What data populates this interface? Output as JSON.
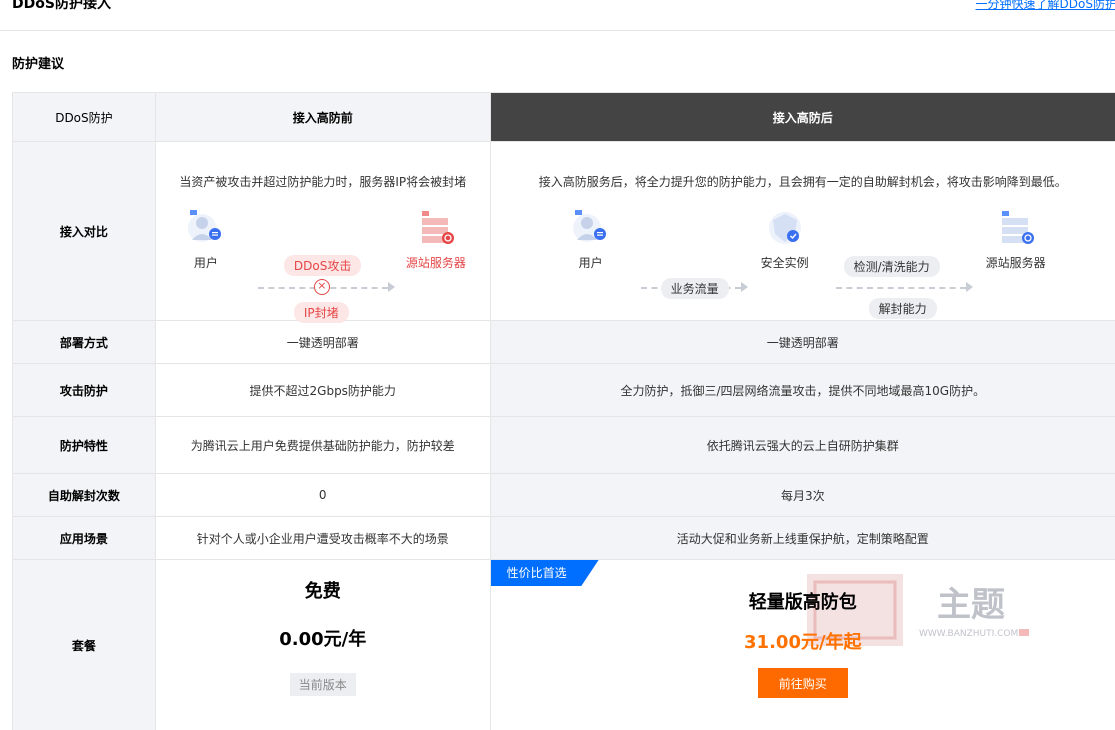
{
  "header": {
    "title": "DDoS防护接入",
    "help_link": "一分钟快速了解DDoS防护"
  },
  "section_title": "防护建议",
  "table": {
    "col_headers": [
      "DDoS防护",
      "接入高防前",
      "接入高防后"
    ],
    "compare_label": "接入对比",
    "before": {
      "caption": "当资产被攻击并超过防护能力时，服务器IP将会被封堵",
      "user_label": "用户",
      "attack_pill": "DDoS攻击",
      "block_pill": "IP封堵",
      "server_label": "源站服务器"
    },
    "after": {
      "caption": "接入高防服务后，将全力提升您的防护能力，且会拥有一定的自助解封机会，将攻击影响降到最低。",
      "user_label": "用户",
      "traffic_pill": "业务流量",
      "instance_label": "安全实例",
      "clean_pill": "检测/清洗能力",
      "unblock_pill": "解封能力",
      "server_label": "源站服务器"
    },
    "rows": [
      {
        "label": "部署方式",
        "before": "一键透明部署",
        "after": "一键透明部署"
      },
      {
        "label": "攻击防护",
        "before": "提供不超过2Gbps防护能力",
        "after": "全力防护，抵御三/四层网络流量攻击，提供不同地域最高10G防护。"
      },
      {
        "label": "防护特性",
        "before": "为腾讯云上用户免费提供基础防护能力，防护较差",
        "after": "依托腾讯云强大的云上自研防护集群"
      },
      {
        "label": "自助解封次数",
        "before": "0",
        "after": "每月3次"
      },
      {
        "label": "应用场景",
        "before": "针对个人或小企业用户遭受攻击概率不大的场景",
        "after": "活动大促和业务新上线重保护航，定制策略配置"
      }
    ],
    "package": {
      "label": "套餐",
      "before_name": "免费",
      "before_price": "0.00元/年",
      "before_badge": "当前版本",
      "ribbon": "性价比首选",
      "after_name": "轻量版高防包",
      "after_price": "31.00元/年起",
      "buy_label": "前往购买"
    }
  },
  "watermark": {
    "title": "主题",
    "url": "WWW.BANZHUTI.COM"
  },
  "colors": {
    "accent": "#006eff",
    "danger": "#e54545",
    "buy": "#ff6a00"
  }
}
